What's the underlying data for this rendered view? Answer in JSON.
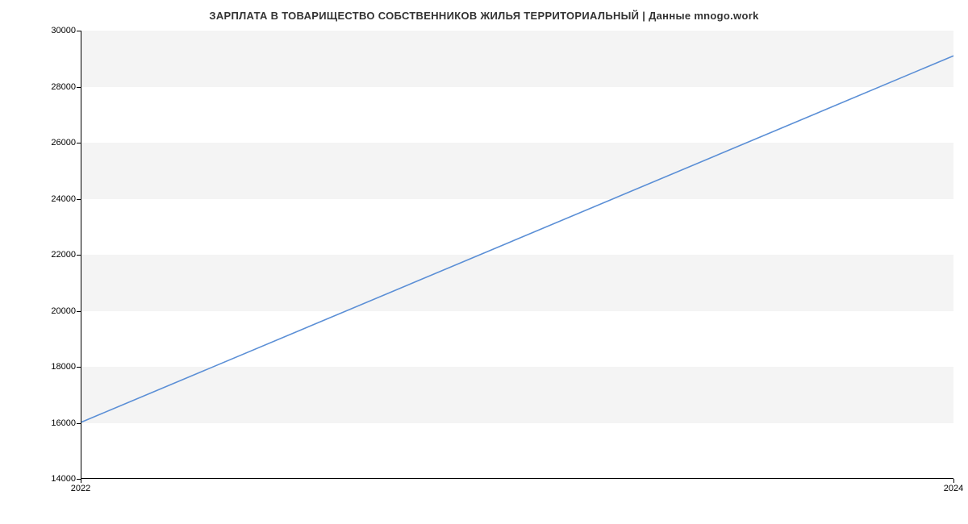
{
  "chart_data": {
    "type": "line",
    "title": "ЗАРПЛАТА В ТОВАРИЩЕСТВО СОБСТВЕННИКОВ ЖИЛЬЯ ТЕРРИТОРИАЛЬНЫЙ | Данные mnogo.work",
    "xlabel": "",
    "ylabel": "",
    "x": [
      2022,
      2024
    ],
    "values": [
      16000,
      29100
    ],
    "x_ticks": [
      2022,
      2024
    ],
    "y_ticks": [
      14000,
      16000,
      18000,
      20000,
      22000,
      24000,
      26000,
      28000,
      30000
    ],
    "ylim": [
      14000,
      30000
    ],
    "xlim": [
      2022,
      2024
    ],
    "line_color": "#5b8fd6",
    "band_color": "#f4f4f4"
  }
}
